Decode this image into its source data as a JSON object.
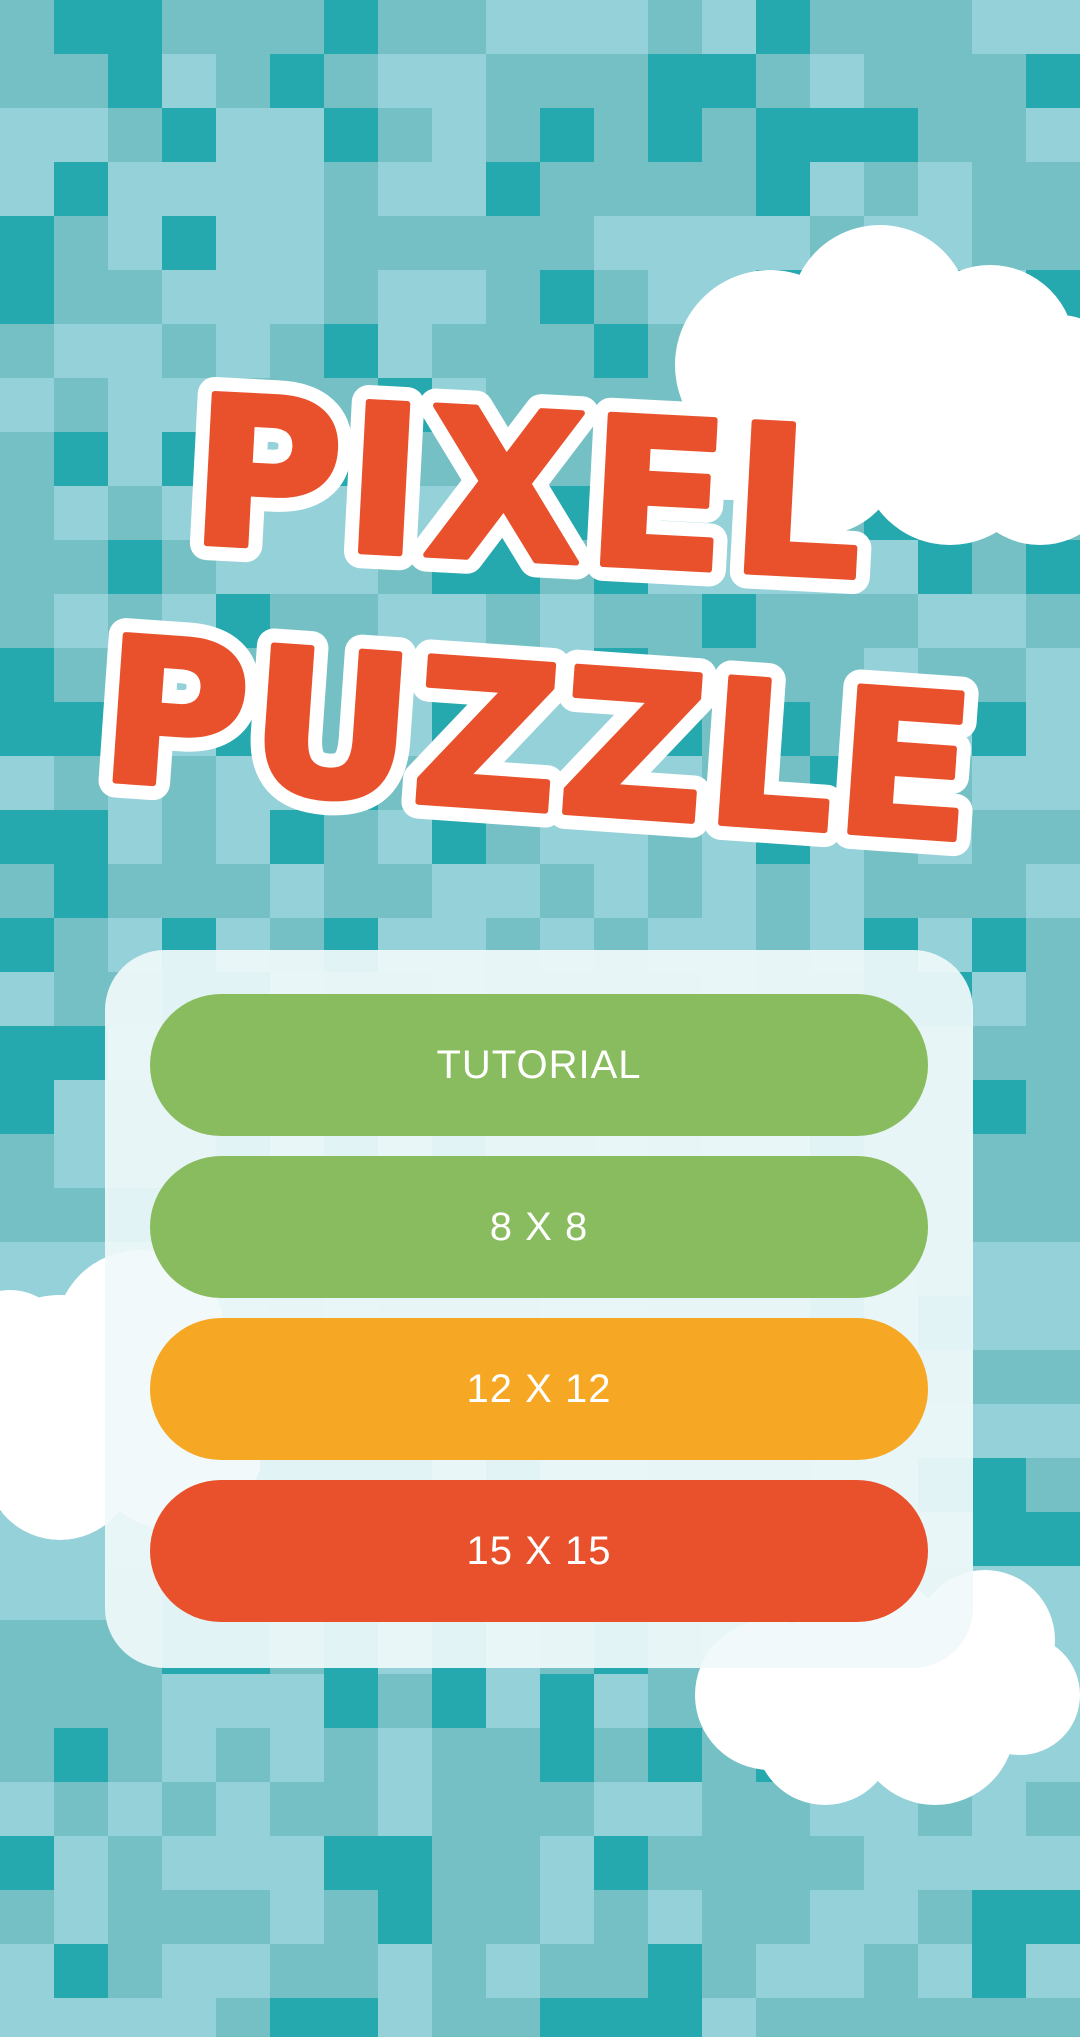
{
  "title": {
    "line1": "PIXEL",
    "line2": "PUZZLE",
    "fill_color": "#e8512b",
    "outline_color": "#ffffff"
  },
  "menu": {
    "buttons": [
      {
        "label": "TUTORIAL",
        "color": "#89bc5e"
      },
      {
        "label": "8 X 8",
        "color": "#89bc5e"
      },
      {
        "label": "12 X 12",
        "color": "#f6a824"
      },
      {
        "label": "15 X 15",
        "color": "#e8512b"
      }
    ]
  },
  "theme": {
    "background_colors": [
      "#74c0c4",
      "#94d1d9",
      "#25a8ae"
    ],
    "cloud_color": "#ffffff",
    "panel_color": "#eef8f9"
  }
}
